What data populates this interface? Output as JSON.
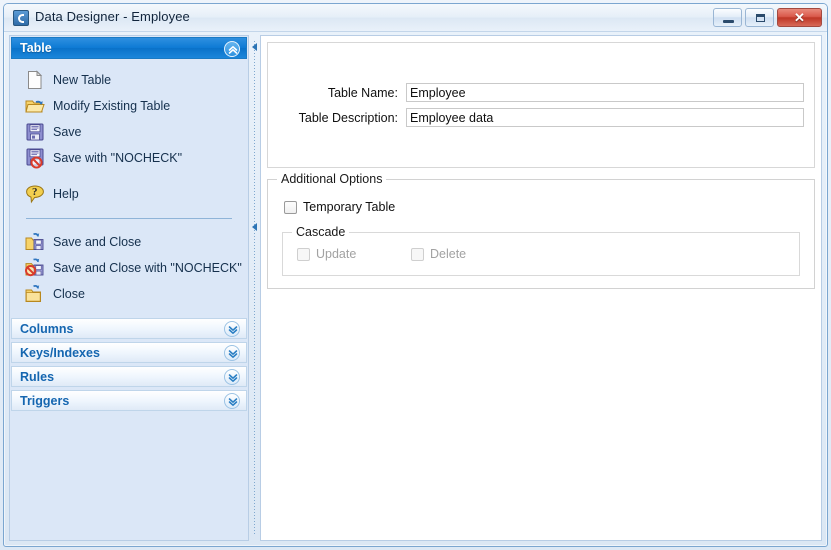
{
  "window": {
    "title": "Data Designer - Employee",
    "icon": "app-icon",
    "controls": {
      "minimize": "minimize-button",
      "maximize": "maximize-button",
      "close_glyph": "✕"
    }
  },
  "sidebar": {
    "active_section": {
      "label": "Table",
      "chevron": "chevron-up-icon"
    },
    "items": [
      {
        "label": "New Table",
        "icon": "new-document-icon"
      },
      {
        "label": "Modify Existing Table",
        "icon": "open-folder-icon"
      },
      {
        "label": "Save",
        "icon": "floppy-disk-icon"
      },
      {
        "label": "Save with \"NOCHECK\"",
        "icon": "floppy-disk-no-check-icon"
      }
    ],
    "help_item": {
      "label": "Help",
      "icon": "question-balloon-icon"
    },
    "close_items": [
      {
        "label": "Save and Close",
        "icon": "folder-save-icon"
      },
      {
        "label": "Save and Close with \"NOCHECK\"",
        "icon": "folder-save-no-check-icon"
      },
      {
        "label": "Close",
        "icon": "folder-close-icon"
      }
    ],
    "collapsed_sections": [
      {
        "label": "Columns",
        "chevron": "chevron-down-icon"
      },
      {
        "label": "Keys/Indexes",
        "chevron": "chevron-down-icon"
      },
      {
        "label": "Rules",
        "chevron": "chevron-down-icon"
      },
      {
        "label": "Triggers",
        "chevron": "chevron-down-icon"
      }
    ]
  },
  "splitter": {
    "collapse_top": "collapse-left-arrow",
    "collapse_bottom": "collapse-left-arrow"
  },
  "main": {
    "fields": [
      {
        "label": "Table Name:",
        "value": "Employee",
        "placeholder": ""
      },
      {
        "label": "Table Description:",
        "value": "Employee data",
        "placeholder": ""
      }
    ],
    "additional_options": {
      "title": "Additional Options",
      "temporary_table": {
        "label": "Temporary Table",
        "checked": false,
        "enabled": true
      },
      "cascade": {
        "title": "Cascade",
        "update": {
          "label": "Update",
          "checked": false,
          "enabled": false
        },
        "delete": {
          "label": "Delete",
          "checked": false,
          "enabled": false
        }
      }
    }
  },
  "colors": {
    "accent_blue": "#0d7ad4",
    "section_link": "#1566b0",
    "sidebar_bg": "#dbe7f7",
    "close_button_red": "#bf3626"
  }
}
